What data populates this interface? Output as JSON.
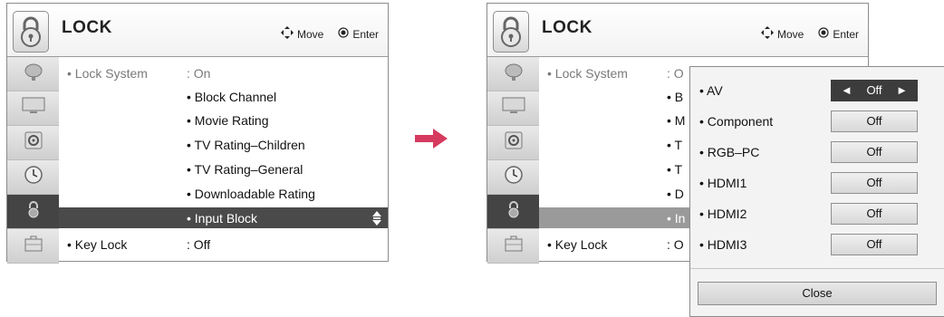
{
  "screens": {
    "left": {
      "title": "LOCK",
      "hint_move": "Move",
      "hint_enter": "Enter",
      "lock_system_label": "• Lock System",
      "lock_system_value": ": On",
      "submenu": [
        "• Block Channel",
        "• Movie Rating",
        "• TV Rating–Children",
        "• TV Rating–General",
        "• Downloadable Rating",
        "• Input Block"
      ],
      "key_lock_label": "• Key Lock",
      "key_lock_value": ": Off"
    },
    "right": {
      "title": "LOCK",
      "hint_move": "Move",
      "hint_enter": "Enter",
      "lock_system_label": "• Lock System",
      "lock_system_value_partial": ": O",
      "submenu_partial": [
        "• B",
        "• M",
        "• T",
        "• T",
        "• D",
        "• In"
      ],
      "key_lock_label": "• Key Lock",
      "key_lock_value_partial": ": O"
    }
  },
  "popup": {
    "rows": [
      {
        "label": "• AV",
        "value": "Off"
      },
      {
        "label": "• Component",
        "value": "Off"
      },
      {
        "label": "• RGB–PC",
        "value": "Off"
      },
      {
        "label": "• HDMI1",
        "value": "Off"
      },
      {
        "label": "• HDMI2",
        "value": "Off"
      },
      {
        "label": "• HDMI3",
        "value": "Off"
      }
    ],
    "left_arrow": "◄",
    "right_arrow": "►",
    "close_label": "Close"
  },
  "colors": {
    "arrow": "#d63a5e",
    "highlight": "#4a4a4a"
  }
}
